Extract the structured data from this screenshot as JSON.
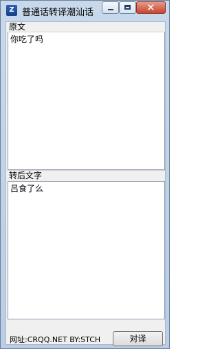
{
  "window": {
    "title": "普通话转译潮汕话",
    "icon": "app-logo-icon",
    "icon_glyph": "Z",
    "controls": {
      "minimize_icon": "minimize-icon",
      "maximize_icon": "maximize-icon",
      "close_icon": "close-icon",
      "close_glyph": "✕"
    }
  },
  "source": {
    "label": "原文",
    "value": "你吃了吗"
  },
  "result": {
    "label": "转后文字",
    "value": "吕食了么"
  },
  "footer": {
    "site_text": "网址:CRQQ.NET BY:STCH",
    "translate_button": "对译"
  },
  "colors": {
    "window_frame": "#b9cde5",
    "close_button": "#c8452d",
    "client_background": "#f0f0f0"
  }
}
